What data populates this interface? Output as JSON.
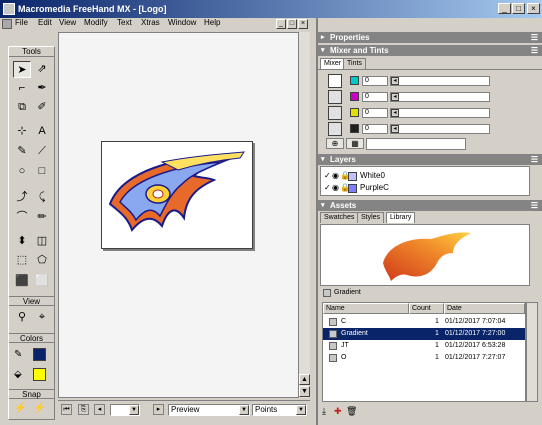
{
  "window": {
    "title": "Macromedia FreeHand MX - [Logo]",
    "controls": {
      "minimize": "_",
      "maximize": "□",
      "close": "×"
    }
  },
  "menu": {
    "items": [
      "File",
      "Edit",
      "View",
      "Modify",
      "Text",
      "Xtras",
      "Window",
      "Help"
    ]
  },
  "toolbox": {
    "tools_label": "Tools",
    "view_label": "View",
    "colors_label": "Colors",
    "snap_label": "Snap",
    "tool_glyphs": [
      "➤",
      "⇗",
      "⌐",
      "✒",
      "⧉",
      "✐",
      "⊹",
      "A",
      "✎",
      "⟋",
      "○",
      "□",
      "⤴",
      "⤹",
      "⌒",
      "✏",
      "⬍",
      "◫",
      "⬚",
      "⬠",
      "⬛",
      "⬜",
      "⚲",
      "⌖"
    ],
    "stroke_color": "#0a246a",
    "fill_color": "#ffff00"
  },
  "status": {
    "view_mode": "Preview",
    "units": "Points"
  },
  "panels": {
    "properties_title": "Properties",
    "mixer_title": "Mixer and Tints",
    "mixer_tabs": [
      "Mixer",
      "Tints"
    ],
    "mixer_values": [
      "0",
      "0",
      "0",
      "0"
    ],
    "mixer_colors": [
      "#00c8c8",
      "#c800c8",
      "#e0e000",
      "#202020"
    ],
    "layers_title": "Layers",
    "layers": [
      {
        "name": "White0",
        "color": "#c0c0ff"
      },
      {
        "name": "PurpleC",
        "color": "#8080ff"
      }
    ],
    "assets_title": "Assets",
    "assets_tabs": [
      "Swatches",
      "Styles",
      "Library"
    ],
    "preview_label": "Gradient",
    "columns": [
      "Name",
      "Count",
      "Date"
    ],
    "rows": [
      {
        "name": "C",
        "count": "1",
        "date": "01/12/2017 7:07:04",
        "selected": false
      },
      {
        "name": "Gradient",
        "count": "1",
        "date": "01/12/2017 7:27:00",
        "selected": true
      },
      {
        "name": "JT",
        "count": "1",
        "date": "01/12/2017 6:53:28",
        "selected": false
      },
      {
        "name": "O",
        "count": "1",
        "date": "01/12/2017 7:27:07",
        "selected": false
      }
    ]
  }
}
